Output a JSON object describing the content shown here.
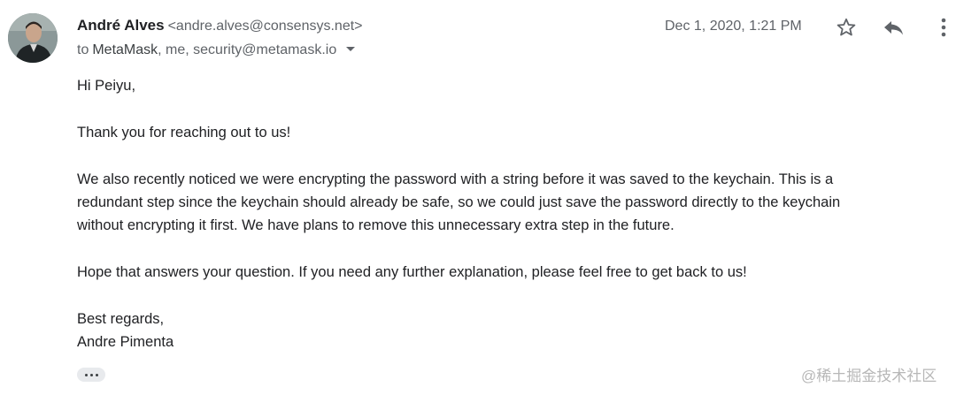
{
  "sender": {
    "name": "André Alves",
    "email": "<andre.alves@consensys.net>"
  },
  "recipients": {
    "prefix": "to",
    "first": "MetaMask",
    "rest": ", me, security@metamask.io"
  },
  "date": "Dec 1, 2020, 1:21 PM",
  "icons": {
    "star": "star-outline-icon",
    "reply": "reply-arrow-icon",
    "more": "more-vertical-icon",
    "details": "caret-down-icon",
    "trimmed": "ellipsis-icon"
  },
  "body": {
    "greeting": "Hi Peiyu,",
    "paragraph1": "Thank you for reaching out to us!",
    "paragraph2_line1": "We also recently noticed we were encrypting the password with a string before it was saved to the keychain. This is a",
    "paragraph2_line2": "redundant step since the keychain should already be safe, so we could just save the password directly to the keychain",
    "paragraph2_line3": "without encrypting it first. We have plans to remove this unnecessary extra step in the future.",
    "paragraph3": "Hope that answers your question. If you need any further explanation, please feel free to get back to us!",
    "closing": "Best regards,",
    "signature": "Andre Pimenta"
  },
  "watermark": "@稀土掘金技术社区",
  "colors": {
    "primary_text": "#202124",
    "secondary_text": "#5f6368",
    "chip_background": "#e8eaed"
  }
}
